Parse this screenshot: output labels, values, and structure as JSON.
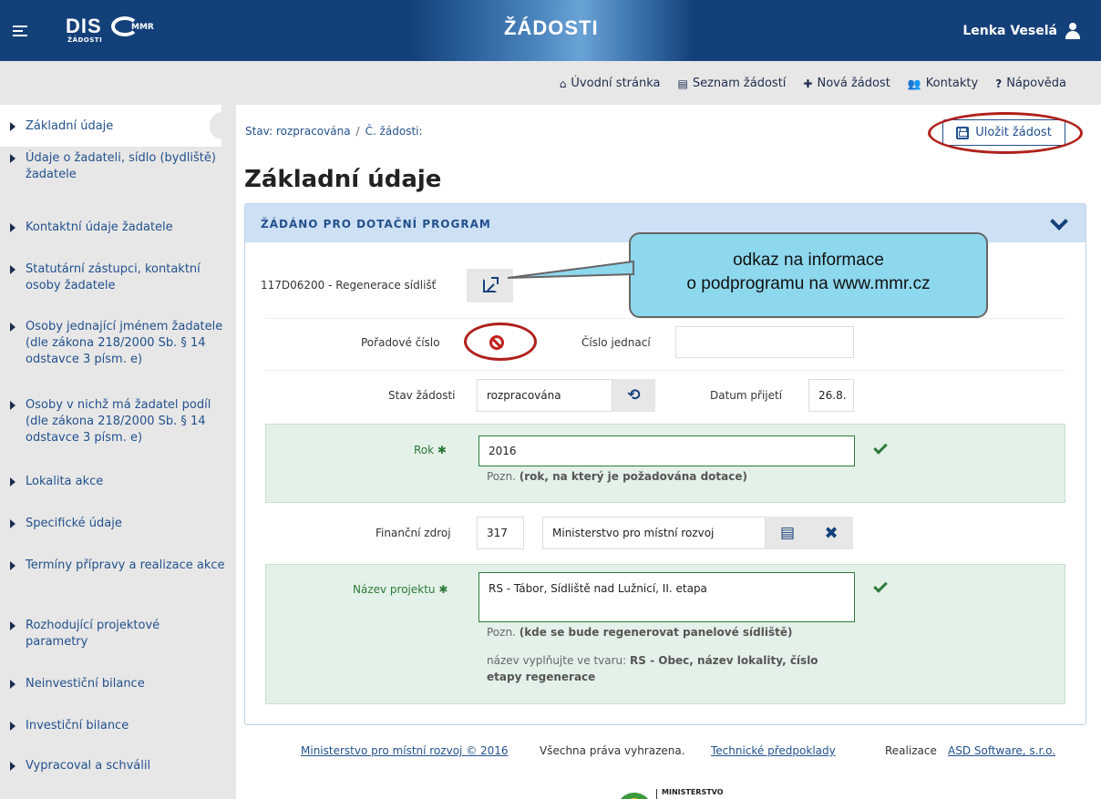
{
  "header": {
    "logo_text": "DIS",
    "logo_sub": "ŽÁDOSTI",
    "logo_mmr": "MMR",
    "banner_title": "ŽÁDOSTI",
    "user_name": "Lenka Veselá",
    "bg_color": "#14407a"
  },
  "topnav": {
    "items": [
      {
        "icon": "home-icon",
        "label": "Úvodní stránka"
      },
      {
        "icon": "list-icon",
        "label": "Seznam žádostí"
      },
      {
        "icon": "plus-icon",
        "label": "Nová žádost"
      },
      {
        "icon": "users-icon",
        "label": "Kontakty"
      },
      {
        "icon": "question-icon",
        "label": "Nápověda"
      }
    ]
  },
  "sidebar": {
    "items": [
      {
        "label": "Základní údaje"
      },
      {
        "label": "Údaje o žadateli, sídlo (bydliště) žadatele"
      },
      {
        "label": "Kontaktní údaje žadatele"
      },
      {
        "label": "Statutární zástupci, kontaktní osoby žadatele"
      },
      {
        "label": "Osoby jednající jménem žadatele (dle zákona 218/2000 Sb. § 14 odstavce 3 písm. e)"
      },
      {
        "label": "Osoby v nichž má žadatel podíl (dle zákona 218/2000 Sb. § 14 odstavce 3 písm. e)"
      },
      {
        "label": "Lokalita akce"
      },
      {
        "label": "Specifické údaje"
      },
      {
        "label": "Termíny přípravy a realizace akce"
      },
      {
        "label": "Rozhodující projektové parametry"
      },
      {
        "label": "Neinvestiční bilance"
      },
      {
        "label": "Investiční bilance"
      },
      {
        "label": "Vypracoval a schválil"
      }
    ]
  },
  "status": {
    "state": "Stav: rozpracována",
    "separator": "/",
    "number": "Č. žádosti:"
  },
  "save_button": "Uložit žádost",
  "page_title": "Základní údaje",
  "panel": {
    "title": "ŽÁDÁNO PRO DOTAČNÍ PROGRAM",
    "program": "117D06200 - Regenerace sídlišť",
    "callout": {
      "line1": "odkaz na informace",
      "line2": "o podprogramu na www.mmr.cz"
    },
    "poradove_cislo_label": "Pořadové číslo",
    "cislo_jednaci_label": "Číslo jednací",
    "cislo_jednaci_value": "",
    "stav_label": "Stav žádosti",
    "stav_value": "rozpracována",
    "datum_label": "Datum přijetí",
    "datum_value": "26.8.",
    "rok_label": "Rok",
    "rok_value": "2016",
    "rok_note_prefix": "Pozn.",
    "rok_note": "(rok, na který je požadována dotace)",
    "zdroj_label": "Finanční zdroj",
    "zdroj_code": "317",
    "zdroj_name": "Ministerstvo pro místní rozvoj",
    "nazev_label": "Název projektu",
    "nazev_value": "RS - Tábor, Sídliště nad Lužnicí, II. etapa",
    "nazev_note_prefix": "Pozn.",
    "nazev_note": "(kde se bude regenerovat panelové sídliště)",
    "nazev_hint_prefix": "název vyplňujte ve tvaru:",
    "nazev_hint": "RS - Obec, název lokality, číslo etapy regenerace",
    "required_mark": "✱"
  },
  "footer": {
    "copyright": "Ministerstvo pro místní rozvoj © 2016",
    "rights": "Všechna práva vyhrazena.",
    "tech": "Technické předpoklady",
    "realizace": "Realizace",
    "company": "ASD Software, s.r.o.",
    "ministry_logo_text": "MINISTERSTVO"
  }
}
